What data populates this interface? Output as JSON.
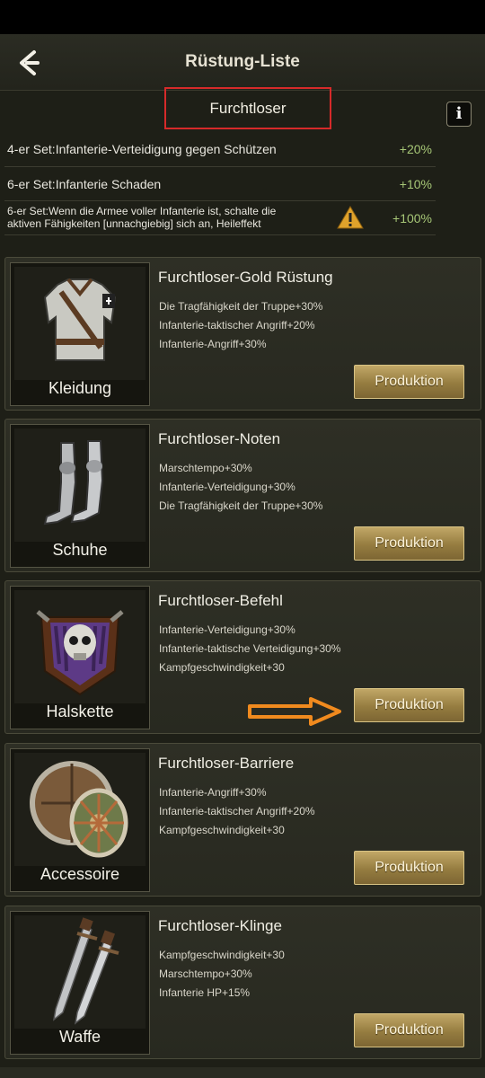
{
  "header": {
    "title": "Rüstung-Liste",
    "back_icon": "back-arrow-icon"
  },
  "set": {
    "name": "Furchtloser",
    "info_label": "i"
  },
  "bonuses": [
    {
      "text": "4-er Set:Infanterie-Verteidigung gegen Schützen",
      "value": "+20%"
    },
    {
      "text": "6-er Set:Infanterie Schaden",
      "value": "+10%"
    },
    {
      "text_line1": "6-er Set:Wenn die Armee voller Infanterie ist, schalte die",
      "text_line2": "aktiven Fähigkeiten [unnachgiebig] sich an, Heileffekt",
      "value": "+100%",
      "icon": "warning-icon"
    }
  ],
  "items": [
    {
      "slot": "Kleidung",
      "name": "Furchtloser-Gold Rüstung",
      "stats": [
        "Die Tragfähigkeit der Truppe+30%",
        "Infanterie-taktischer Angriff+20%",
        "Infanterie-Angriff+30%"
      ],
      "button": "Produktion",
      "icon": "armor-icon"
    },
    {
      "slot": "Schuhe",
      "name": "Furchtloser-Noten",
      "stats": [
        "Marschtempo+30%",
        "Infanterie-Verteidigung+30%",
        "Die Tragfähigkeit der Truppe+30%"
      ],
      "button": "Produktion",
      "icon": "greaves-icon"
    },
    {
      "slot": "Halskette",
      "name": "Furchtloser-Befehl",
      "stats": [
        "Infanterie-Verteidigung+30%",
        "Infanterie-taktische Verteidigung+30%",
        "Kampfgeschwindigkeit+30"
      ],
      "button": "Produktion",
      "icon": "skull-emblem-icon"
    },
    {
      "slot": "Accessoire",
      "name": "Furchtloser-Barriere",
      "stats": [
        "Infanterie-Angriff+30%",
        "Infanterie-taktischer Angriff+20%",
        "Kampfgeschwindigkeit+30"
      ],
      "button": "Produktion",
      "icon": "shield-icon"
    },
    {
      "slot": "Waffe",
      "name": "Furchtloser-Klinge",
      "stats": [
        "Kampfgeschwindigkeit+30",
        "Marschtempo+30%",
        "Infanterie HP+15%"
      ],
      "button": "Produktion",
      "icon": "sword-icon"
    }
  ],
  "colors": {
    "accent_gold": "#a88f52",
    "bonus_green": "#a7c777",
    "highlight_red": "#d62a2a",
    "arrow_orange": "#f08a1e"
  }
}
